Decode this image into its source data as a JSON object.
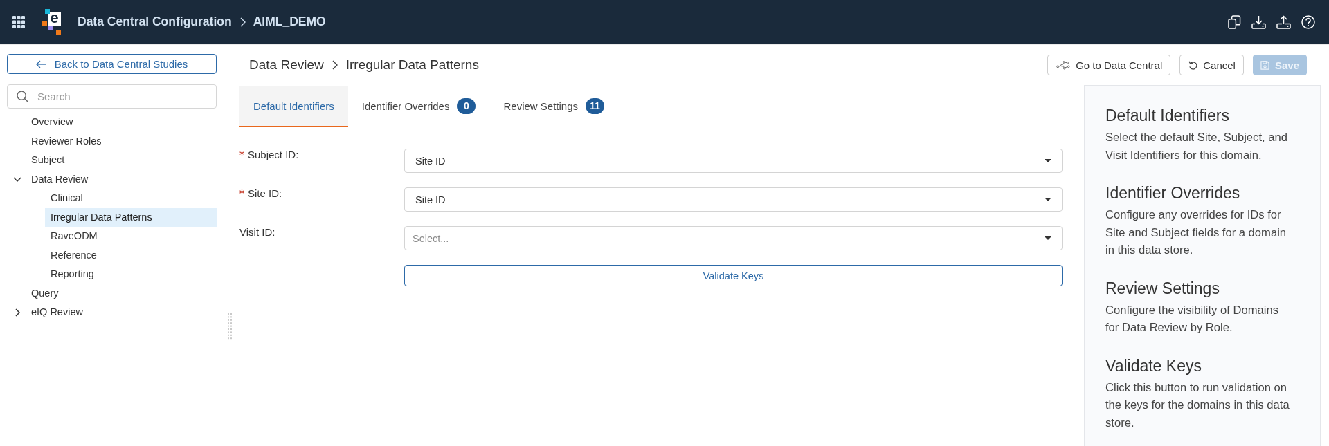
{
  "header": {
    "logo_text": "e",
    "title": "Data Central Configuration",
    "study": "AIML_DEMO"
  },
  "sidebar": {
    "back_button": "Back to Data Central Studies",
    "search": {
      "placeholder": "Search"
    },
    "tree": [
      {
        "label": "Overview",
        "selected": false
      },
      {
        "label": "Reviewer Roles",
        "selected": false
      },
      {
        "label": "Subject",
        "selected": false
      },
      {
        "label": "Data Review",
        "selected": false,
        "expanded": true,
        "children": [
          {
            "label": "Clinical",
            "selected": false
          },
          {
            "label": "Irregular Data Patterns",
            "selected": true
          },
          {
            "label": "RaveODM",
            "selected": false
          },
          {
            "label": "Reference",
            "selected": false
          },
          {
            "label": "Reporting",
            "selected": false
          }
        ]
      },
      {
        "label": "Query",
        "selected": false
      },
      {
        "label": "eIQ Review",
        "selected": false,
        "expanded": false
      }
    ]
  },
  "page": {
    "breadcrumb": [
      "Data Review",
      "Irregular Data Patterns"
    ],
    "actions": [
      {
        "kind": "goto",
        "label": "Go to Data Central",
        "disabled": false
      },
      {
        "kind": "cancel",
        "label": "Cancel",
        "disabled": false
      },
      {
        "kind": "save",
        "label": "Save",
        "disabled": true
      }
    ]
  },
  "tabs": [
    {
      "label": "Default Identifiers",
      "selected": true
    },
    {
      "label": "Identifier Overrides",
      "count": "0",
      "selected": false
    },
    {
      "label": "Review Settings",
      "count": "11",
      "selected": false
    }
  ],
  "form": {
    "fields": [
      {
        "label": "Subject ID:",
        "required": true,
        "value": "Site ID"
      },
      {
        "label": "Site ID:",
        "required": true,
        "value": "Site ID"
      },
      {
        "label": "Visit ID:",
        "required": false,
        "placeholder": "Select..."
      }
    ],
    "validate_button": "Validate Keys"
  },
  "help_panel": {
    "sections": [
      {
        "title": "Default Identifiers",
        "text": "Select the default Site, Subject, and Visit Identifiers for this domain."
      },
      {
        "title": "Identifier Overrides",
        "text": "Configure any overrides for IDs for Site and Subject fields for a domain in this data store."
      },
      {
        "title": "Review Settings",
        "text": "Configure the visibility of Domains for Data Review by Role."
      },
      {
        "title": "Validate Keys",
        "text": "Click this button to run validation on the keys for the domains in this data store."
      }
    ]
  }
}
